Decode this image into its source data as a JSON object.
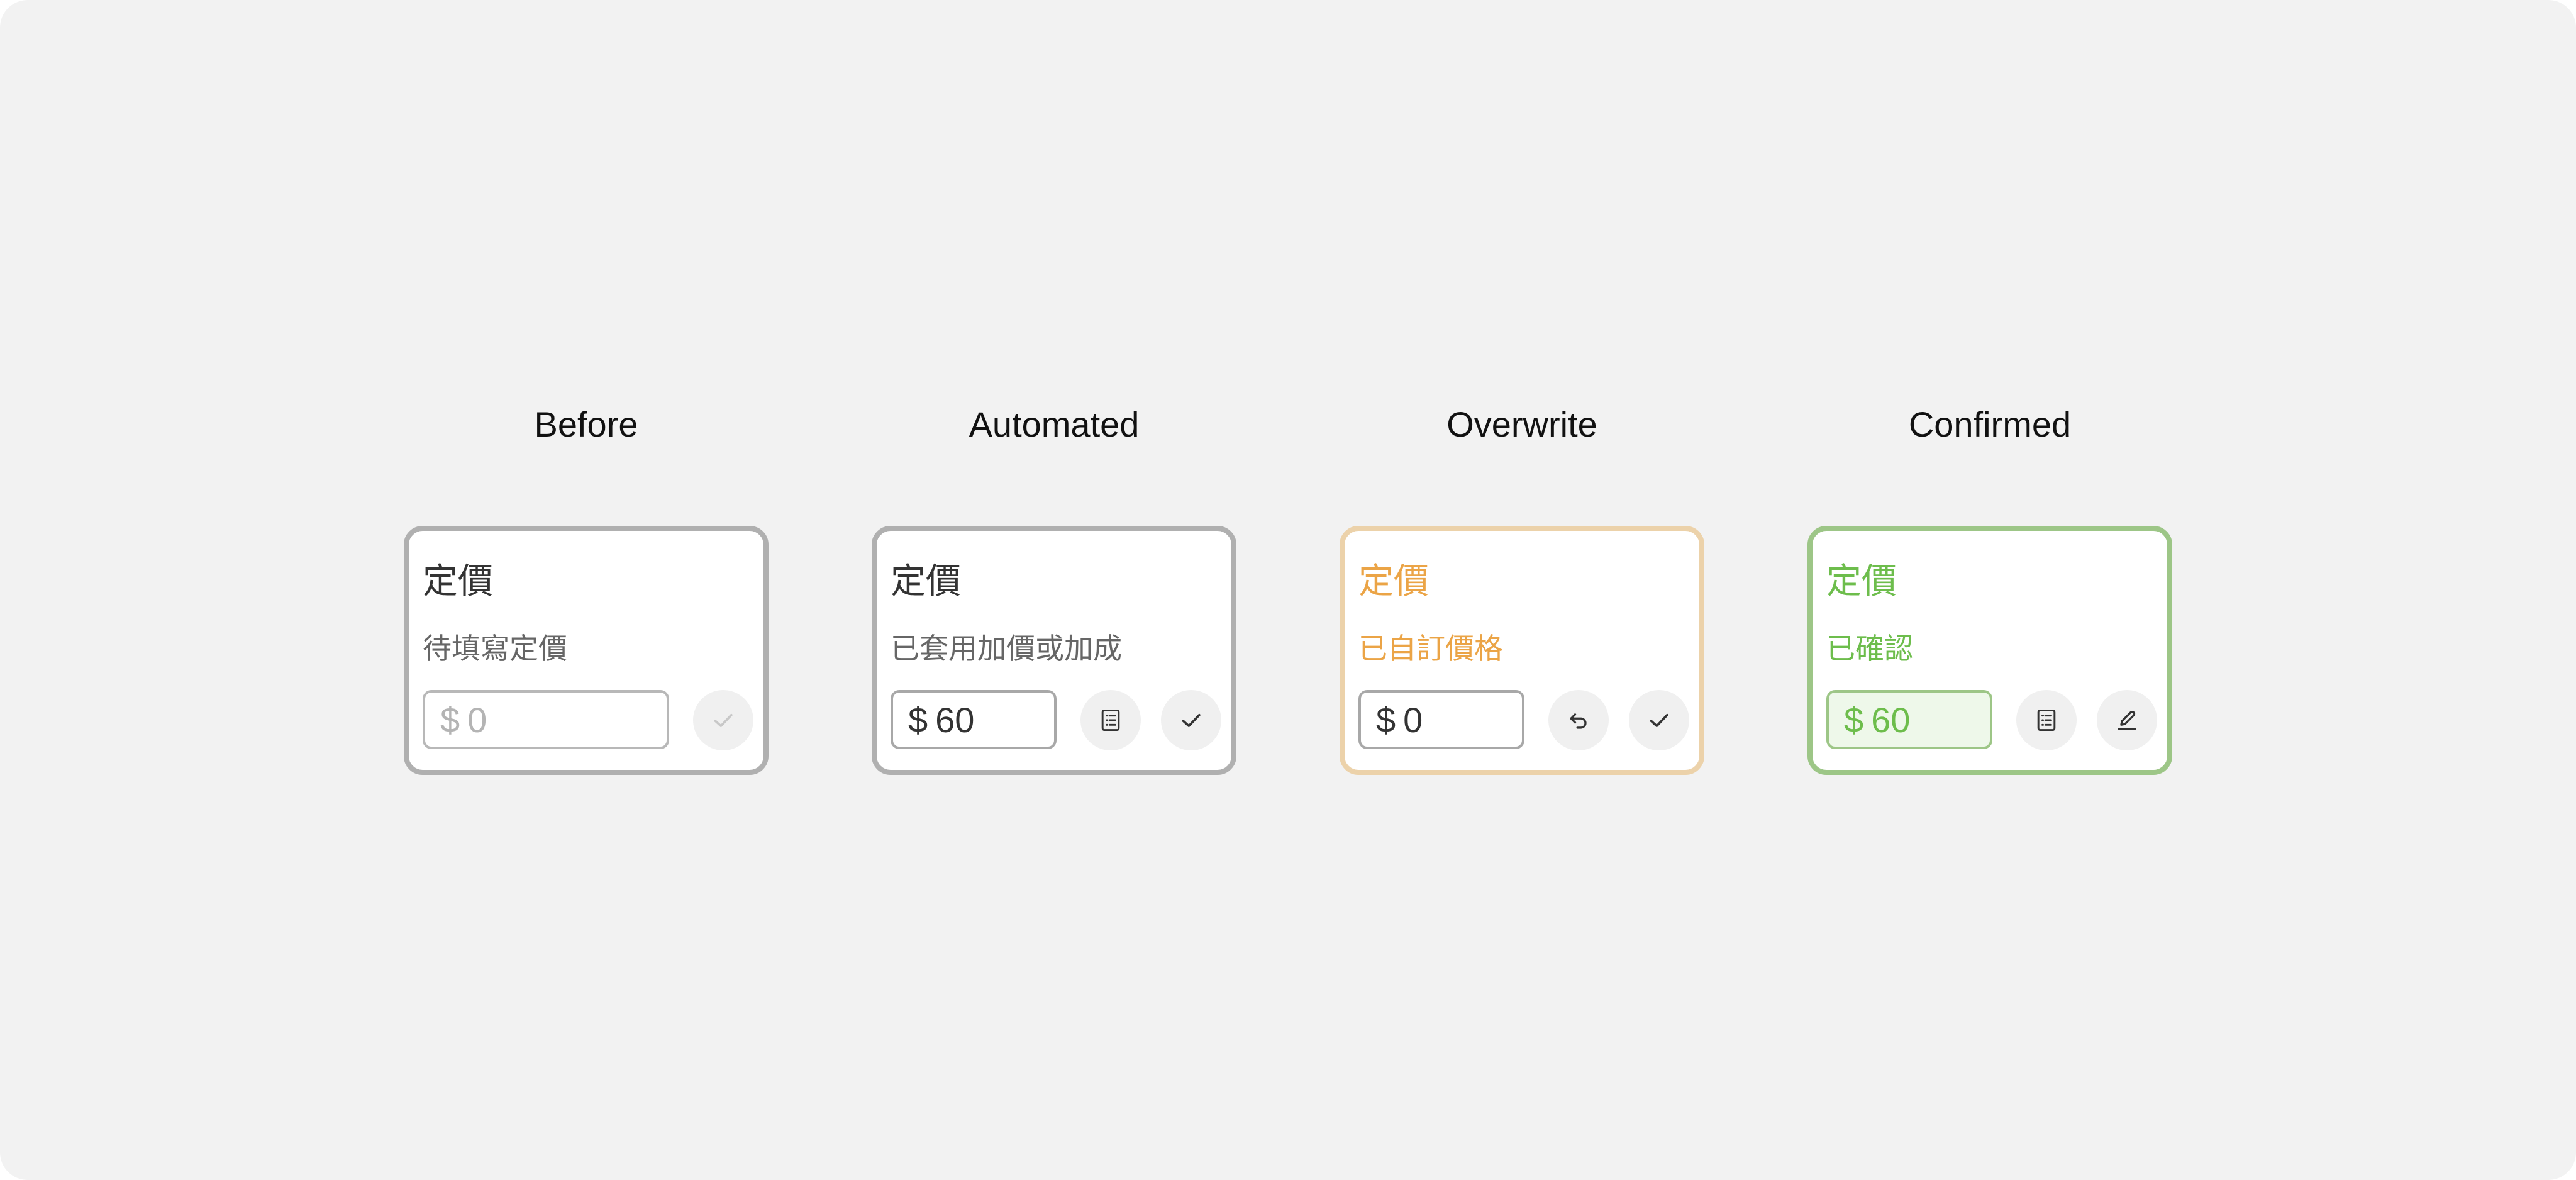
{
  "states": [
    {
      "heading": "Before",
      "field_label": "定價",
      "status": "待填寫定價",
      "currency": "$",
      "price": "0",
      "actions": [
        {
          "icon": "check-icon",
          "enabled": false
        }
      ]
    },
    {
      "heading": "Automated",
      "field_label": "定價",
      "status": "已套用加價或加成",
      "currency": "$",
      "price": "60",
      "actions": [
        {
          "icon": "list-icon",
          "enabled": true
        },
        {
          "icon": "check-icon",
          "enabled": true
        }
      ]
    },
    {
      "heading": "Overwrite",
      "field_label": "定價",
      "status": "已自訂價格",
      "currency": "$",
      "price": "0",
      "actions": [
        {
          "icon": "undo-icon",
          "enabled": true
        },
        {
          "icon": "check-icon",
          "enabled": true
        }
      ]
    },
    {
      "heading": "Confirmed",
      "field_label": "定價",
      "status": "已確認",
      "currency": "$",
      "price": "60",
      "actions": [
        {
          "icon": "list-icon",
          "enabled": true
        },
        {
          "icon": "edit-icon",
          "enabled": true
        }
      ]
    }
  ],
  "colors": {
    "canvas": "#f2f2f2",
    "neutral_border": "#b0b0b0",
    "overwrite_accent": "#eba446",
    "overwrite_border": "#ecd2aa",
    "confirmed_accent": "#6dbd4c",
    "confirmed_border": "#9dc687",
    "confirmed_fill": "#eef8ea"
  }
}
